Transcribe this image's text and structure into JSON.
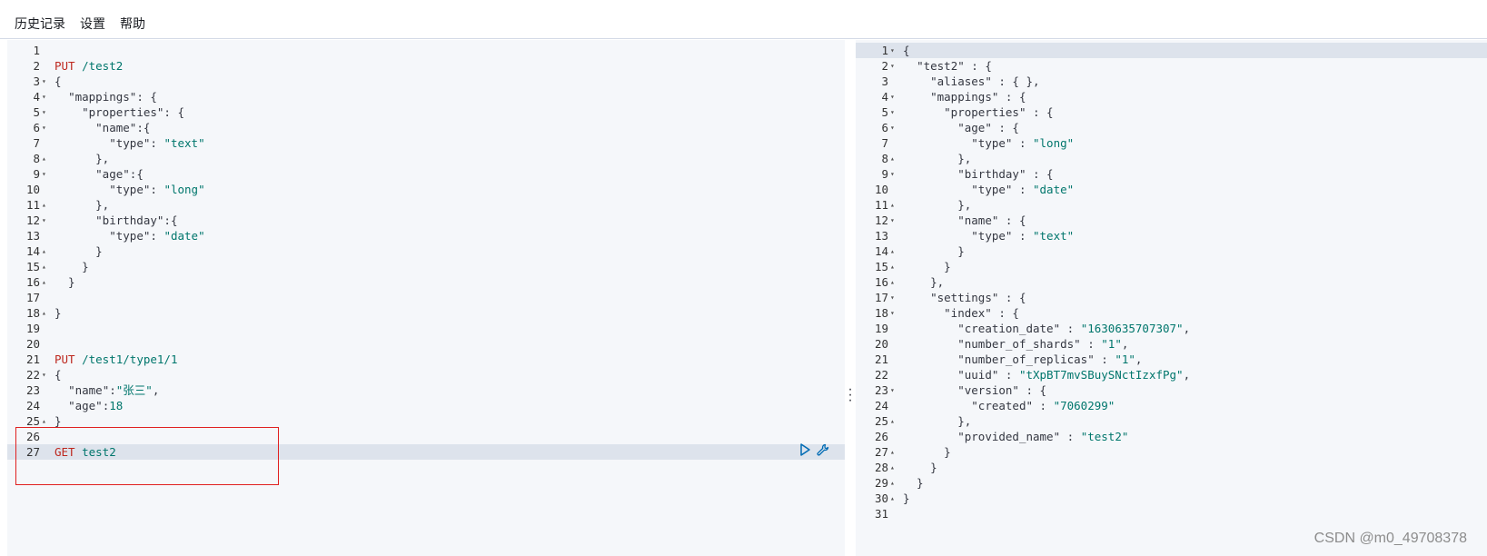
{
  "menu": {
    "history": "历史记录",
    "settings": "设置",
    "help": "帮助"
  },
  "request_editor": {
    "lines": [
      {
        "n": "1",
        "fold": "",
        "text": ""
      },
      {
        "n": "2",
        "fold": "",
        "text": "PUT /test2"
      },
      {
        "n": "3",
        "fold": "▾",
        "text": "{"
      },
      {
        "n": "4",
        "fold": "▾",
        "text": "  \"mappings\": {"
      },
      {
        "n": "5",
        "fold": "▾",
        "text": "    \"properties\": {"
      },
      {
        "n": "6",
        "fold": "▾",
        "text": "      \"name\":{"
      },
      {
        "n": "7",
        "fold": "",
        "text": "        \"type\": \"text\""
      },
      {
        "n": "8",
        "fold": "▴",
        "text": "      },"
      },
      {
        "n": "9",
        "fold": "▾",
        "text": "      \"age\":{"
      },
      {
        "n": "10",
        "fold": "",
        "text": "        \"type\": \"long\""
      },
      {
        "n": "11",
        "fold": "▴",
        "text": "      },"
      },
      {
        "n": "12",
        "fold": "▾",
        "text": "      \"birthday\":{"
      },
      {
        "n": "13",
        "fold": "",
        "text": "        \"type\": \"date\""
      },
      {
        "n": "14",
        "fold": "▴",
        "text": "      }"
      },
      {
        "n": "15",
        "fold": "▴",
        "text": "    }"
      },
      {
        "n": "16",
        "fold": "▴",
        "text": "  }"
      },
      {
        "n": "17",
        "fold": "",
        "text": ""
      },
      {
        "n": "18",
        "fold": "▴",
        "text": "}"
      },
      {
        "n": "19",
        "fold": "",
        "text": ""
      },
      {
        "n": "20",
        "fold": "",
        "text": ""
      },
      {
        "n": "21",
        "fold": "",
        "text": "PUT /test1/type1/1"
      },
      {
        "n": "22",
        "fold": "▾",
        "text": "{"
      },
      {
        "n": "23",
        "fold": "",
        "text": "  \"name\":\"张三\","
      },
      {
        "n": "24",
        "fold": "",
        "text": "  \"age\":18"
      },
      {
        "n": "25",
        "fold": "▴",
        "text": "}"
      },
      {
        "n": "26",
        "fold": "",
        "text": ""
      },
      {
        "n": "27",
        "fold": "",
        "text": "GET test2"
      }
    ],
    "active_line": "27",
    "run_icon": "play-icon",
    "options_icon": "wrench-icon"
  },
  "response_viewer": {
    "lines": [
      {
        "n": "1",
        "fold": "▾",
        "text": "{"
      },
      {
        "n": "2",
        "fold": "▾",
        "text": "  \"test2\" : {"
      },
      {
        "n": "3",
        "fold": "",
        "text": "    \"aliases\" : { },"
      },
      {
        "n": "4",
        "fold": "▾",
        "text": "    \"mappings\" : {"
      },
      {
        "n": "5",
        "fold": "▾",
        "text": "      \"properties\" : {"
      },
      {
        "n": "6",
        "fold": "▾",
        "text": "        \"age\" : {"
      },
      {
        "n": "7",
        "fold": "",
        "text": "          \"type\" : \"long\""
      },
      {
        "n": "8",
        "fold": "▴",
        "text": "        },"
      },
      {
        "n": "9",
        "fold": "▾",
        "text": "        \"birthday\" : {"
      },
      {
        "n": "10",
        "fold": "",
        "text": "          \"type\" : \"date\""
      },
      {
        "n": "11",
        "fold": "▴",
        "text": "        },"
      },
      {
        "n": "12",
        "fold": "▾",
        "text": "        \"name\" : {"
      },
      {
        "n": "13",
        "fold": "",
        "text": "          \"type\" : \"text\""
      },
      {
        "n": "14",
        "fold": "▴",
        "text": "        }"
      },
      {
        "n": "15",
        "fold": "▴",
        "text": "      }"
      },
      {
        "n": "16",
        "fold": "▴",
        "text": "    },"
      },
      {
        "n": "17",
        "fold": "▾",
        "text": "    \"settings\" : {"
      },
      {
        "n": "18",
        "fold": "▾",
        "text": "      \"index\" : {"
      },
      {
        "n": "19",
        "fold": "",
        "text": "        \"creation_date\" : \"1630635707307\","
      },
      {
        "n": "20",
        "fold": "",
        "text": "        \"number_of_shards\" : \"1\","
      },
      {
        "n": "21",
        "fold": "",
        "text": "        \"number_of_replicas\" : \"1\","
      },
      {
        "n": "22",
        "fold": "",
        "text": "        \"uuid\" : \"tXpBT7mvSBuySNctIzxfPg\","
      },
      {
        "n": "23",
        "fold": "▾",
        "text": "        \"version\" : {"
      },
      {
        "n": "24",
        "fold": "",
        "text": "          \"created\" : \"7060299\""
      },
      {
        "n": "25",
        "fold": "▴",
        "text": "        },"
      },
      {
        "n": "26",
        "fold": "",
        "text": "        \"provided_name\" : \"test2\""
      },
      {
        "n": "27",
        "fold": "▴",
        "text": "      }"
      },
      {
        "n": "28",
        "fold": "▴",
        "text": "    }"
      },
      {
        "n": "29",
        "fold": "▴",
        "text": "  }"
      },
      {
        "n": "30",
        "fold": "▴",
        "text": "}"
      },
      {
        "n": "31",
        "fold": "",
        "text": ""
      }
    ],
    "active_line": "1"
  },
  "watermark": "CSDN @m0_49708378",
  "colors": {
    "method": "#bd271e",
    "string": "#00766c",
    "active_line": "#dde3ec",
    "highlight_box": "#e02020"
  }
}
